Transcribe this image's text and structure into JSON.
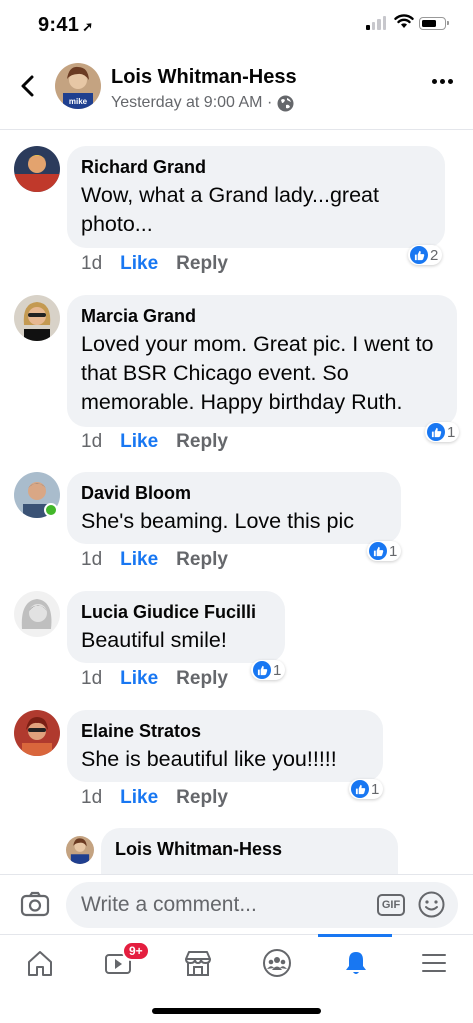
{
  "status": {
    "time": "9:41"
  },
  "header": {
    "name": "Lois Whitman-Hess",
    "meta": "Yesterday at 9:00 AM ·",
    "avatar_text": "mike"
  },
  "comments": [
    {
      "author": "Richard Grand",
      "text": "Wow,  what  a Grand  lady...great photo...",
      "time": "1d",
      "like": "Like",
      "reply": "Reply",
      "reactions": "2",
      "avatar_color": "#c0392b"
    },
    {
      "author": "Marcia Grand",
      "text": "Loved your mom. Great pic. I went to that BSR Chicago event. So memorable. Happy birthday Ruth.",
      "time": "1d",
      "like": "Like",
      "reply": "Reply",
      "reactions": "1",
      "avatar_color": "#8a6d4b"
    },
    {
      "author": "David Bloom",
      "text": "She's beaming. Love this pic",
      "time": "1d",
      "like": "Like",
      "reply": "Reply",
      "reactions": "1",
      "avatar_color": "#8fa3b8"
    },
    {
      "author": "Lucia Giudice Fucilli",
      "text": "Beautiful smile!",
      "time": "1d",
      "like": "Like",
      "reply": "Reply",
      "reactions": "1",
      "avatar_color": "#cfcfcf"
    },
    {
      "author": "Elaine Stratos",
      "text": "She is beautiful like you!!!!!",
      "time": "1d",
      "like": "Like",
      "reply": "Reply",
      "reactions": "1",
      "avatar_color": "#b03a2e"
    }
  ],
  "reply_preview": {
    "author": "Lois Whitman-Hess"
  },
  "composer": {
    "placeholder": "Write a comment...",
    "gif_label": "GIF"
  },
  "tabbar": {
    "video_badge": "9+"
  },
  "colors": {
    "accent": "#1877f2",
    "bubble": "#f0f2f5",
    "secondary_text": "#65676b"
  }
}
